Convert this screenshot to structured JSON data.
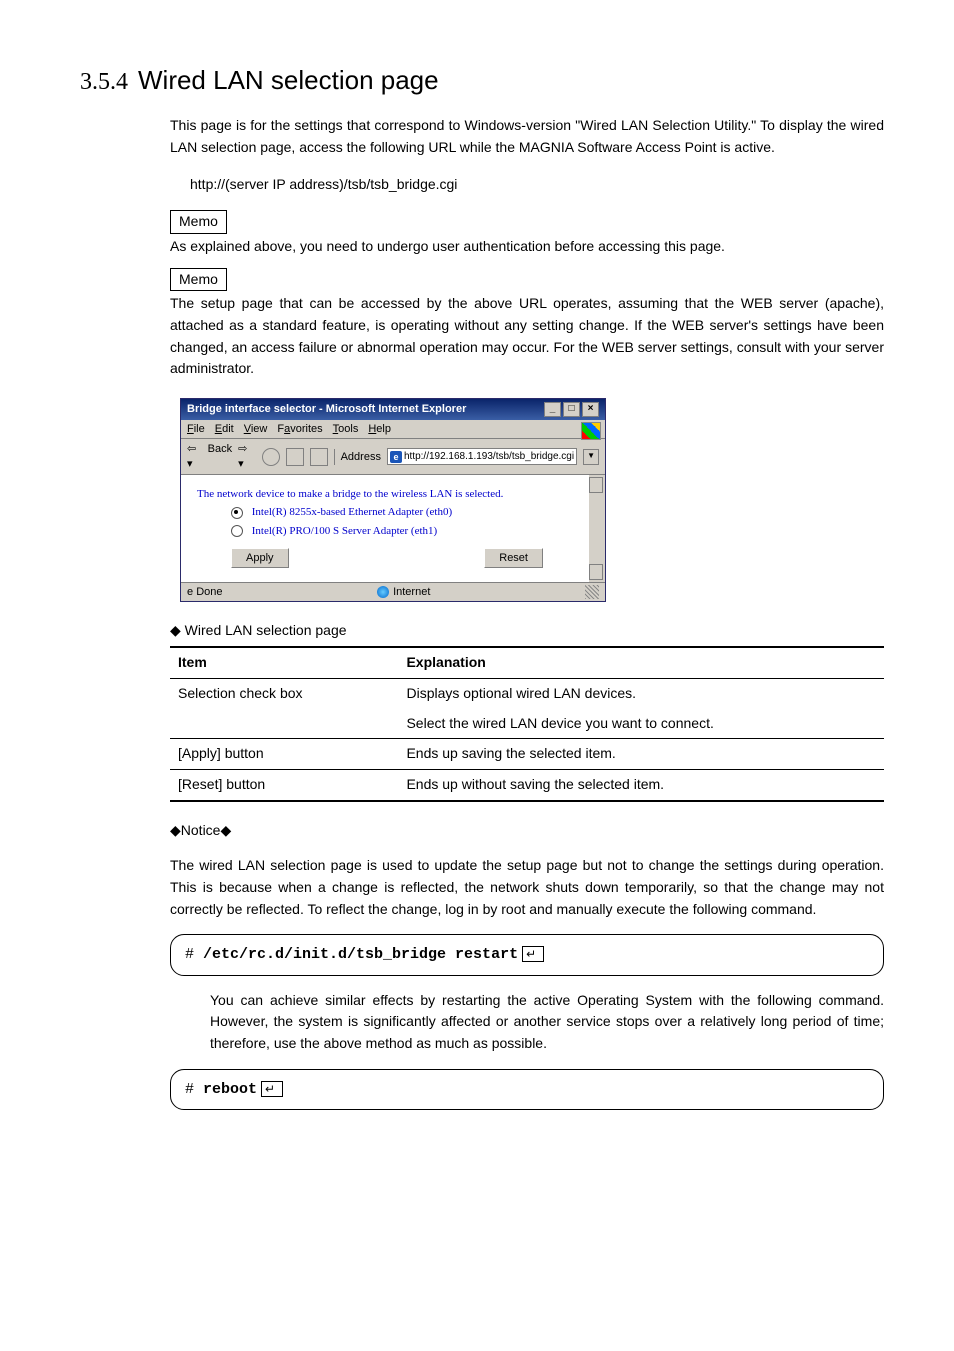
{
  "heading": {
    "num": "3.5.4",
    "title": "Wired LAN selection page"
  },
  "intro": "This page is for the settings that correspond to Windows-version \"Wired LAN Selection Utility.\" To display the wired LAN selection page, access the following URL while the MAGNIA Software Access Point is active.",
  "url_line": "http://(server IP address)/tsb/tsb_bridge.cgi",
  "memo_label": "Memo",
  "memo1": "As explained above, you need to undergo user authentication before accessing this page.",
  "memo2": "The setup page that can be accessed by the above URL operates, assuming that the WEB server (apache), attached as a standard feature, is operating without any setting change.  If the WEB server's settings have been changed, an access failure or abnormal operation may occur.  For the WEB server settings, consult with your server administrator.",
  "browser": {
    "title": "Bridge interface selector - Microsoft Internet Explorer",
    "menu": {
      "file": "File",
      "edit": "Edit",
      "view": "View",
      "favorites": "Favorites",
      "tools": "Tools",
      "help": "Help"
    },
    "back": "Back",
    "address_label": "Address",
    "address_url": "http://192.168.1.193/tsb/tsb_bridge.cgi",
    "page_text": "The network device to make a bridge to the wireless LAN is selected.",
    "radio1": "Intel(R) 8255x-based Ethernet Adapter (eth0)",
    "radio2": "Intel(R) PRO/100 S Server Adapter (eth1)",
    "apply": "Apply",
    "reset": "Reset",
    "status_done": "Done",
    "status_zone": "Internet"
  },
  "subhead": "Wired LAN selection page",
  "table": {
    "h_item": "Item",
    "h_expl": "Explanation",
    "r1_item": "Selection check box",
    "r1_exp_a": "Displays optional wired LAN devices.",
    "r1_exp_b": "Select the wired LAN device you want to connect.",
    "r2_item": "[Apply] button",
    "r2_exp": "Ends up saving the selected item.",
    "r3_item": "[Reset] button",
    "r3_exp": "Ends up without saving the selected item."
  },
  "notice_label": "Notice",
  "notice_text": "The wired LAN selection page is used to update the setup page but not to change the settings during operation.  This is because when a change is reflected, the network shuts down temporarily, so that the change may not correctly be reflected.  To reflect the change, log in by root and manually execute the following command.",
  "cmd1": "/etc/rc.d/init.d/tsb_bridge restart",
  "after_cmd": "You can achieve similar effects by restarting the active Operating System with the following command.  However, the system is significantly affected or another service stops over a relatively long period of time; therefore, use the above method as much as possible.",
  "cmd2": "reboot"
}
